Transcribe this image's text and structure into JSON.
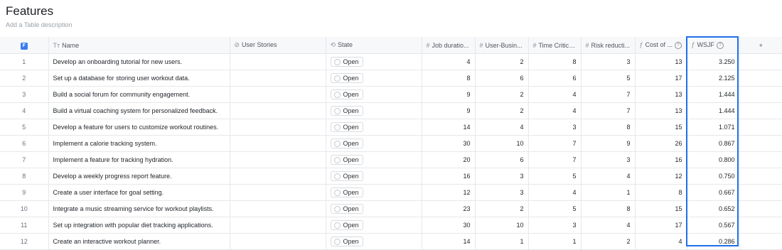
{
  "page": {
    "title": "Features",
    "description_placeholder": "Add a Table description"
  },
  "columns": {
    "select_badge": "F",
    "name": "Name",
    "user_stories": "User Stories",
    "state": "State",
    "job_duration": "Job duratio...",
    "user_business": "User-Busin...",
    "time_critical": "Time Critica...",
    "risk_reduction": "Risk reducti...",
    "cost_of": "Cost of ...",
    "wsjf": "WSJF",
    "add_column": "+"
  },
  "icons": {
    "name": "text-type-icon",
    "user_stories": "link-icon",
    "state": "refresh-icon",
    "number": "hash-icon",
    "formula": "formula-icon",
    "help": "help-circle-icon"
  },
  "colors": {
    "accent": "#1f6feb",
    "badge": "#3a7bf2"
  },
  "rows": [
    {
      "idx": "1",
      "name": "Develop an onboarding tutorial for new users.",
      "state": "Open",
      "job": "4",
      "ub": "2",
      "tc": "8",
      "rr": "3",
      "cost": "13",
      "wsjf": "3.250"
    },
    {
      "idx": "2",
      "name": "Set up a database for storing user workout data.",
      "state": "Open",
      "job": "8",
      "ub": "6",
      "tc": "6",
      "rr": "5",
      "cost": "17",
      "wsjf": "2.125"
    },
    {
      "idx": "3",
      "name": "Build a social forum for community engagement.",
      "state": "Open",
      "job": "9",
      "ub": "2",
      "tc": "4",
      "rr": "7",
      "cost": "13",
      "wsjf": "1.444"
    },
    {
      "idx": "4",
      "name": "Build a virtual coaching system for personalized feedback.",
      "state": "Open",
      "job": "9",
      "ub": "2",
      "tc": "4",
      "rr": "7",
      "cost": "13",
      "wsjf": "1.444"
    },
    {
      "idx": "5",
      "name": "Develop a feature for users to customize workout routines.",
      "state": "Open",
      "job": "14",
      "ub": "4",
      "tc": "3",
      "rr": "8",
      "cost": "15",
      "wsjf": "1.071"
    },
    {
      "idx": "6",
      "name": "Implement a calorie tracking system.",
      "state": "Open",
      "job": "30",
      "ub": "10",
      "tc": "7",
      "rr": "9",
      "cost": "26",
      "wsjf": "0.867"
    },
    {
      "idx": "7",
      "name": "Implement a feature for tracking hydration.",
      "state": "Open",
      "job": "20",
      "ub": "6",
      "tc": "7",
      "rr": "3",
      "cost": "16",
      "wsjf": "0.800"
    },
    {
      "idx": "8",
      "name": "Develop a weekly progress report feature.",
      "state": "Open",
      "job": "16",
      "ub": "3",
      "tc": "5",
      "rr": "4",
      "cost": "12",
      "wsjf": "0.750"
    },
    {
      "idx": "9",
      "name": "Create a user interface for goal setting.",
      "state": "Open",
      "job": "12",
      "ub": "3",
      "tc": "4",
      "rr": "1",
      "cost": "8",
      "wsjf": "0.667"
    },
    {
      "idx": "10",
      "name": "Integrate a music streaming service for workout playlists.",
      "state": "Open",
      "job": "23",
      "ub": "2",
      "tc": "5",
      "rr": "8",
      "cost": "15",
      "wsjf": "0.652"
    },
    {
      "idx": "11",
      "name": "Set up integration with popular diet tracking applications.",
      "state": "Open",
      "job": "30",
      "ub": "10",
      "tc": "3",
      "rr": "4",
      "cost": "17",
      "wsjf": "0.567"
    },
    {
      "idx": "12",
      "name": "Create an interactive workout planner.",
      "state": "Open",
      "job": "14",
      "ub": "1",
      "tc": "1",
      "rr": "2",
      "cost": "4",
      "wsjf": "0.286"
    }
  ]
}
